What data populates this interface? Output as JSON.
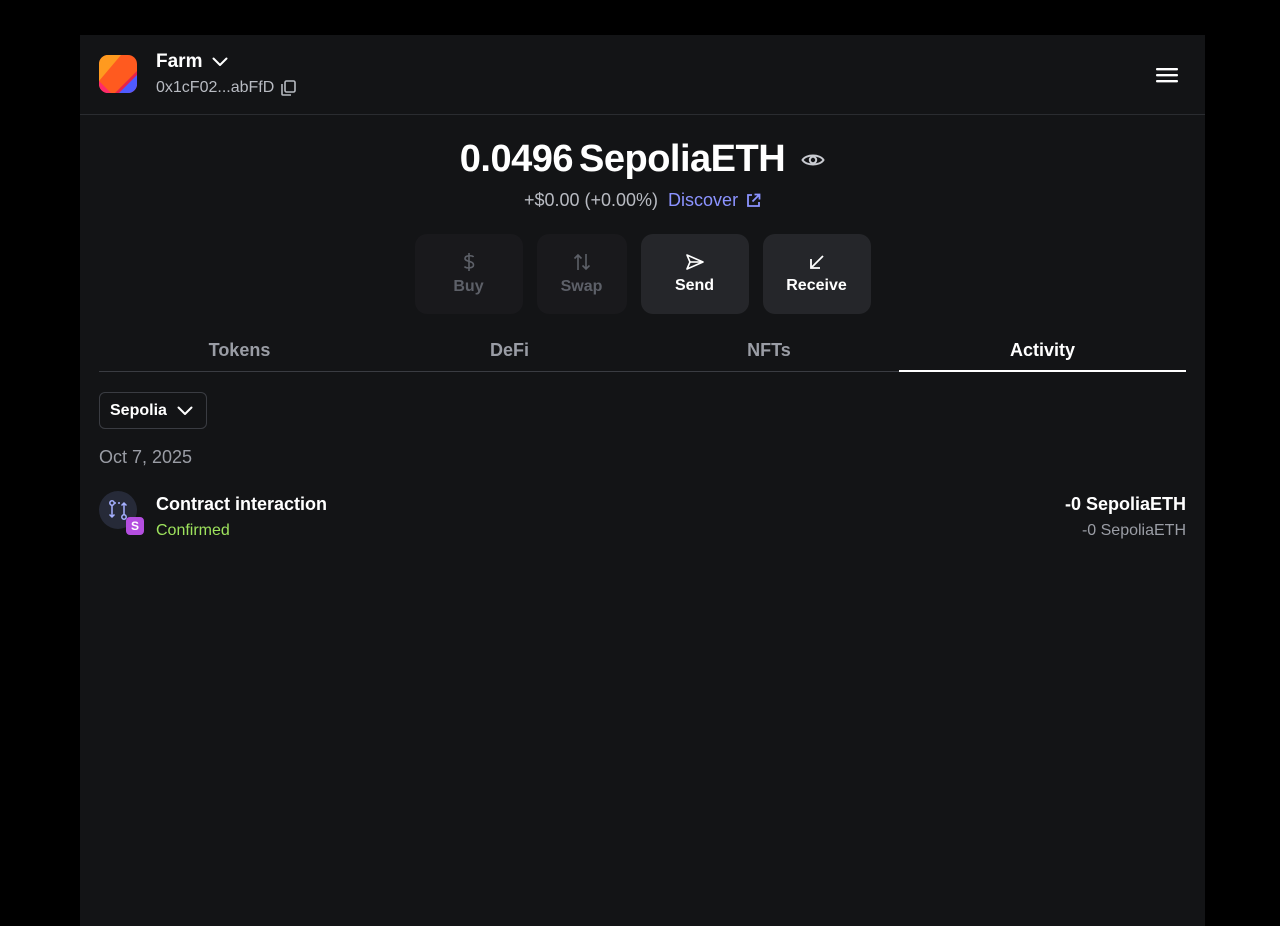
{
  "colors": {
    "page_background": "#000000",
    "panel_background": "#131416",
    "accent_link": "#8b93ff",
    "status_confirmed": "#9ee35d",
    "network_badge": "#b44ee0"
  },
  "header": {
    "account_name": "Farm",
    "account_address": "0x1cF02...abFfD",
    "icons": [
      "account-logo",
      "chevron-down-icon",
      "copy-icon",
      "hamburger-menu-icon"
    ]
  },
  "balance": {
    "amount": "0.0496",
    "unit": "SepoliaETH",
    "change": "+$0.00 (+0.00%)",
    "discover_label": "Discover"
  },
  "actions": {
    "buy": "Buy",
    "swap": "Swap",
    "send": "Send",
    "receive": "Receive"
  },
  "tabs": {
    "tokens": "Tokens",
    "defi": "DeFi",
    "nfts": "NFTs",
    "activity": "Activity",
    "active": "Activity"
  },
  "filter": {
    "network": "Sepolia"
  },
  "activity": {
    "date": "Oct 7, 2025",
    "items": [
      {
        "title": "Contract interaction",
        "status": "Confirmed",
        "network_badge": "S",
        "amount_primary": "-0 SepoliaETH",
        "amount_secondary": "-0 SepoliaETH"
      }
    ]
  }
}
